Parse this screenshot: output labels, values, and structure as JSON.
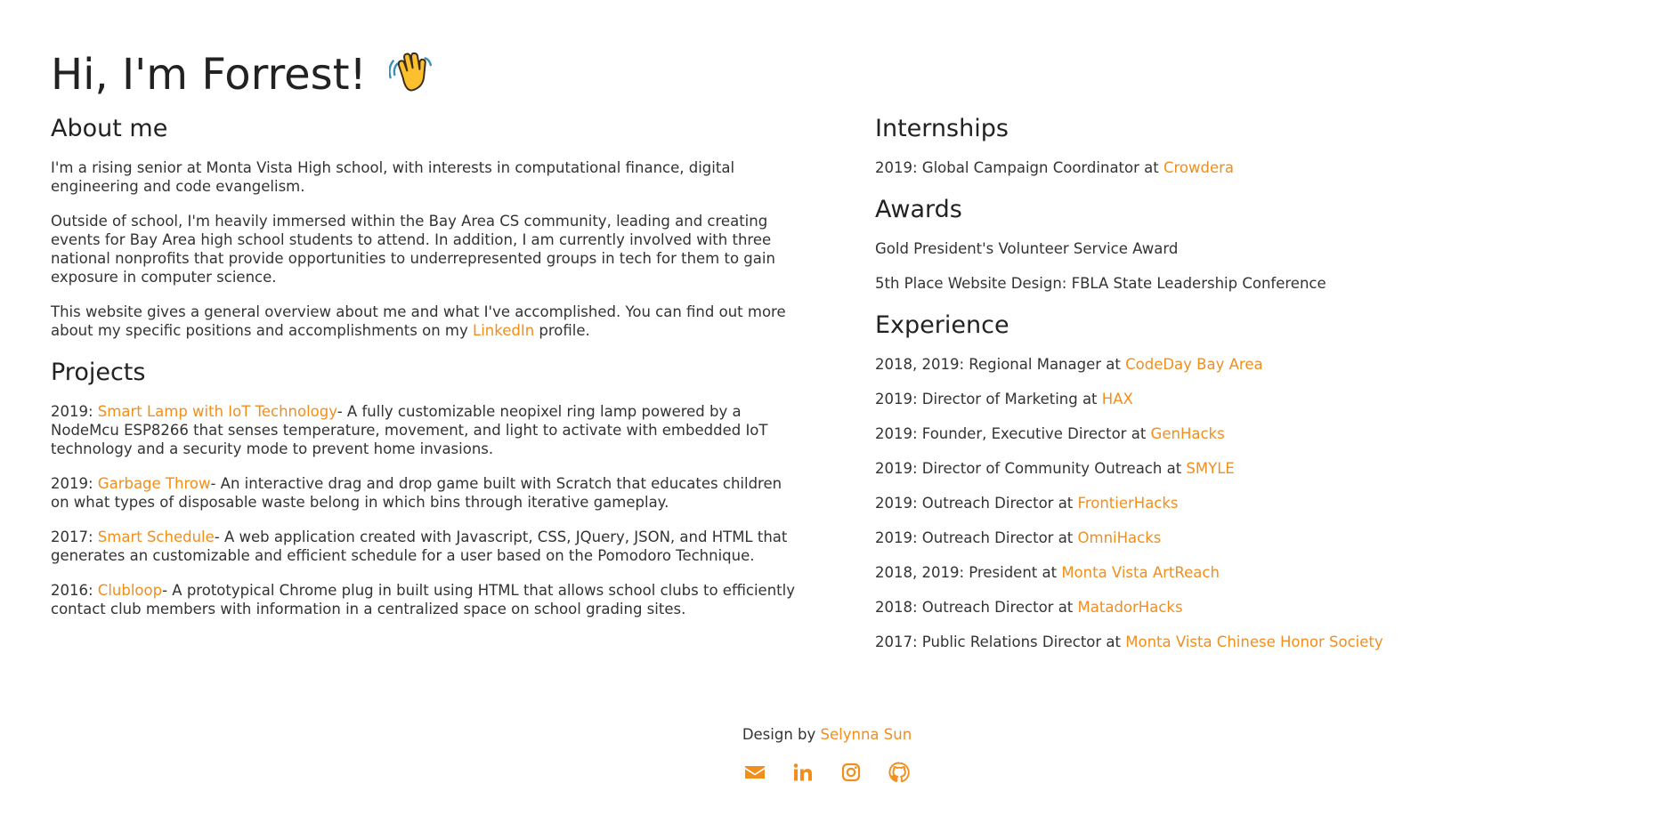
{
  "header": {
    "title": "Hi, I'm Forrest!",
    "emoji_icon": "waving-hand-icon"
  },
  "about": {
    "heading": "About me",
    "paragraph1": "I'm a rising senior at Monta Vista High school, with interests in computational finance, digital engineering and code evangelism.",
    "paragraph2": "Outside of school, I'm heavily immersed within the Bay Area CS community, leading and creating events for Bay Area high school students to attend. In addition, I am currently involved with three national nonprofits that provide opportunities to underrepresented groups in tech for them to gain exposure in computer science.",
    "paragraph3_before": "This website gives a general overview about me and what I've accomplished. You can find out more about my specific positions and accomplishments on my ",
    "paragraph3_link": "LinkedIn",
    "paragraph3_after": " profile."
  },
  "projects": {
    "heading": "Projects",
    "items": [
      {
        "year": "2019: ",
        "name": "Smart Lamp with IoT Technology",
        "desc": "- A fully customizable neopixel ring lamp powered by a NodeMcu ESP8266 that senses temperature, movement, and light to activate with embedded IoT technology and a security mode to prevent home invasions."
      },
      {
        "year": "2019: ",
        "name": "Garbage Throw",
        "desc": "- An interactive drag and drop game built with Scratch that educates children on what types of disposable waste belong in which bins through iterative gameplay."
      },
      {
        "year": "2017: ",
        "name": "Smart Schedule",
        "desc": "- A web application created with Javascript, CSS, JQuery, JSON, and HTML that generates an customizable and efficient schedule for a user based on the Pomodoro Technique."
      },
      {
        "year": "2016: ",
        "name": "Clubloop",
        "desc": "- A prototypical Chrome plug in built using HTML that allows school clubs to efficiently contact club members with information in a centralized space on school grading sites."
      }
    ]
  },
  "internships": {
    "heading": "Internships",
    "items": [
      {
        "text": "2019: Global Campaign Coordinator at ",
        "org": "Crowdera"
      }
    ]
  },
  "awards": {
    "heading": "Awards",
    "items": [
      "Gold President's Volunteer Service Award",
      "5th Place Website Design: FBLA State Leadership Conference"
    ]
  },
  "experience": {
    "heading": "Experience",
    "items": [
      {
        "text": "2018, 2019: Regional Manager at ",
        "org": "CodeDay Bay Area"
      },
      {
        "text": "2019: Director of Marketing at ",
        "org": "HAX"
      },
      {
        "text": "2019: Founder, Executive Director at ",
        "org": "GenHacks"
      },
      {
        "text": "2019: Director of Community Outreach at ",
        "org": "SMYLE"
      },
      {
        "text": "2019: Outreach Director at ",
        "org": "FrontierHacks"
      },
      {
        "text": "2019: Outreach Director at ",
        "org": "OmniHacks"
      },
      {
        "text": "2018, 2019: President at ",
        "org": "Monta Vista ArtReach"
      },
      {
        "text": "2018: Outreach Director at ",
        "org": "MatadorHacks"
      },
      {
        "text": "2017: Public Relations Director at ",
        "org": "Monta Vista Chinese Honor Society"
      }
    ]
  },
  "footer": {
    "credit_prefix": "Design by ",
    "credit_name": "Selynna Sun",
    "social_icons": [
      "envelope-icon",
      "linkedin-icon",
      "instagram-icon",
      "github-icon"
    ]
  },
  "colors": {
    "accent": "#f28e1c",
    "text": "#333333",
    "heading": "#222222",
    "background": "#ffffff"
  }
}
